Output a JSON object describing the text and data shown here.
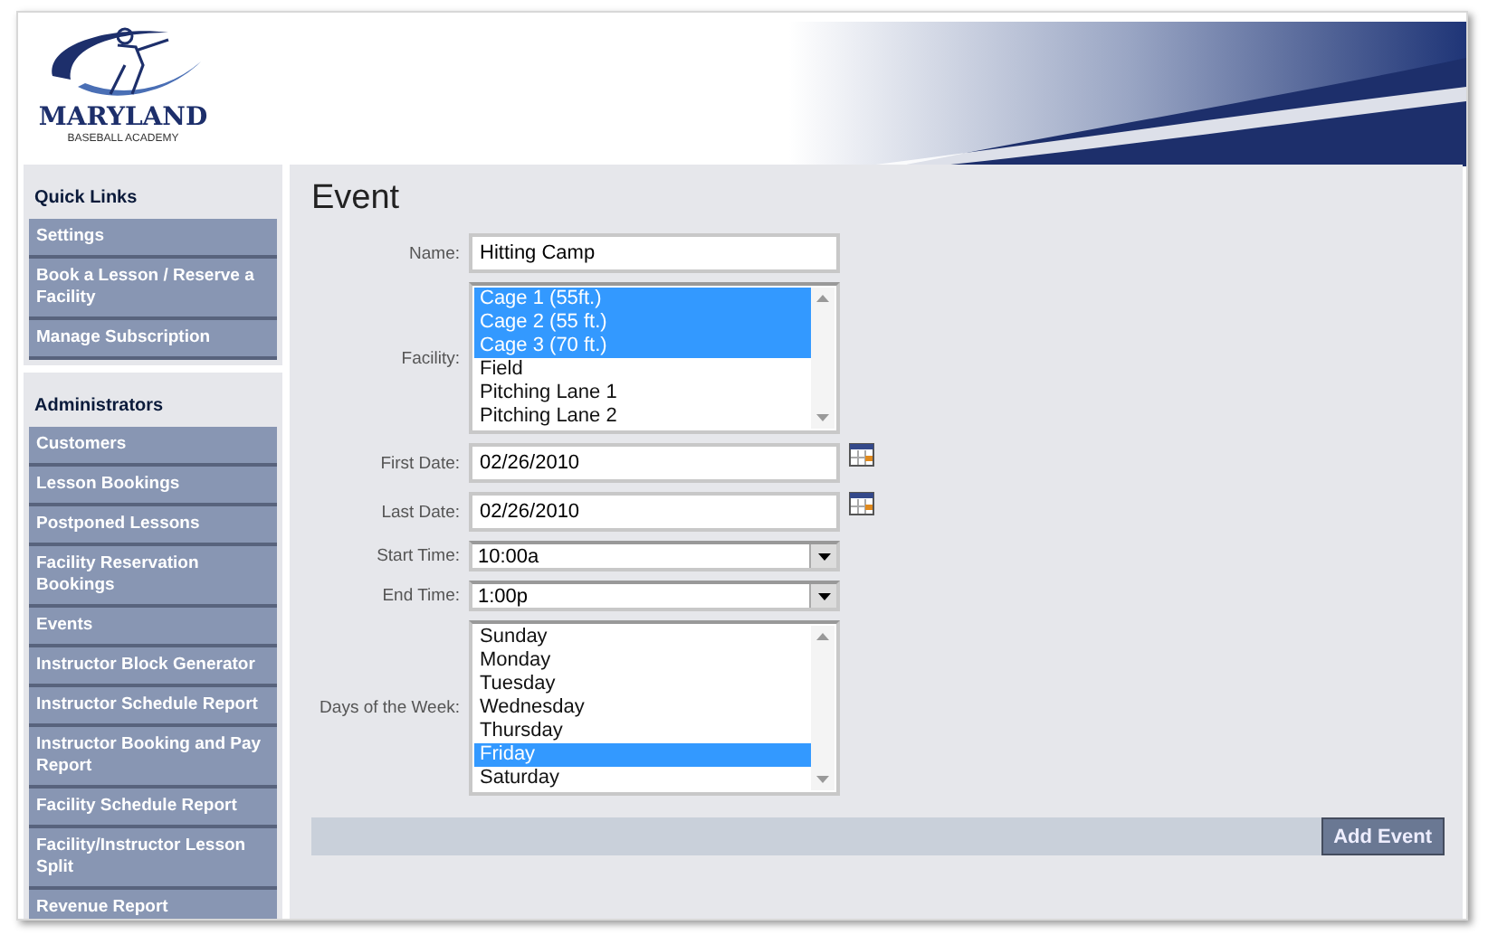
{
  "logo": {
    "name": "MARYLAND",
    "tagline": "BASEBALL ACADEMY"
  },
  "sidebar": [
    {
      "title": "Quick Links",
      "items": [
        {
          "label": "Settings"
        },
        {
          "label": "Book a Lesson / Reserve a Facility"
        },
        {
          "label": "Manage Subscription"
        }
      ]
    },
    {
      "title": "Administrators",
      "items": [
        {
          "label": "Customers"
        },
        {
          "label": "Lesson Bookings"
        },
        {
          "label": "Postponed Lessons"
        },
        {
          "label": "Facility Reservation Bookings"
        },
        {
          "label": "Events"
        },
        {
          "label": "Instructor Block Generator"
        },
        {
          "label": "Instructor Schedule Report"
        },
        {
          "label": "Instructor Booking and Pay Report"
        },
        {
          "label": "Facility Schedule Report"
        },
        {
          "label": "Facility/Instructor Lesson Split"
        },
        {
          "label": "Revenue Report"
        }
      ]
    }
  ],
  "page_title": "Event",
  "fields": [
    {
      "kind": "text",
      "label": "Name:",
      "value": "Hitting Camp"
    },
    {
      "kind": "list",
      "label": "Facility:",
      "options": [
        {
          "label": "Cage 1 (55ft.)",
          "selected": true
        },
        {
          "label": "Cage 2 (55 ft.)",
          "selected": true
        },
        {
          "label": "Cage 3 (70 ft.)",
          "selected": true
        },
        {
          "label": "Field",
          "selected": false
        },
        {
          "label": "Pitching Lane 1",
          "selected": false
        },
        {
          "label": "Pitching Lane 2",
          "selected": false
        }
      ]
    },
    {
      "kind": "date",
      "label": "First Date:",
      "value": "02/26/2010"
    },
    {
      "kind": "date",
      "label": "Last Date:",
      "value": "02/26/2010"
    },
    {
      "kind": "select",
      "label": "Start Time:",
      "value": "10:00a"
    },
    {
      "kind": "select",
      "label": "End Time:",
      "value": "1:00p"
    },
    {
      "kind": "list",
      "label": "Days of the Week:",
      "options": [
        {
          "label": "Sunday",
          "selected": false
        },
        {
          "label": "Monday",
          "selected": false
        },
        {
          "label": "Tuesday",
          "selected": false
        },
        {
          "label": "Wednesday",
          "selected": false
        },
        {
          "label": "Thursday",
          "selected": false
        },
        {
          "label": "Friday",
          "selected": true
        },
        {
          "label": "Saturday",
          "selected": false
        }
      ]
    }
  ],
  "submit": "Add Event"
}
